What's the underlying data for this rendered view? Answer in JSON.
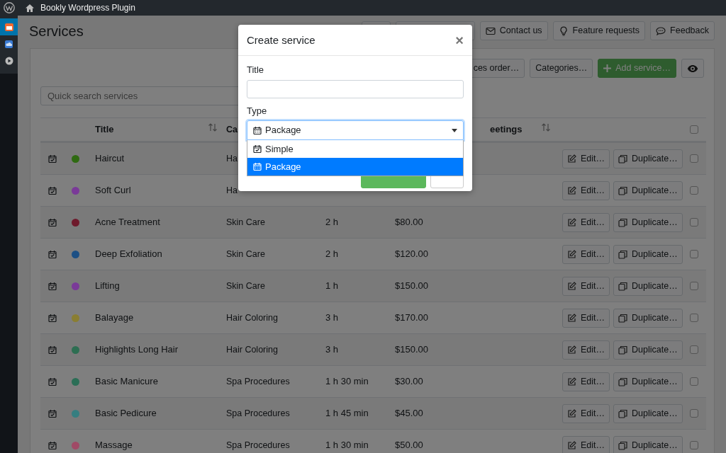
{
  "admin_bar": {
    "site": "Bookly Wordpress Plugin"
  },
  "sidebar": {
    "items": [
      {
        "kind": "calendar",
        "selected": true
      },
      {
        "kind": "cloud",
        "selected": false
      },
      {
        "kind": "play",
        "selected": false
      }
    ]
  },
  "page_title": "Services",
  "header_buttons": [
    {
      "kind": "envelope",
      "label": "Contact us"
    },
    {
      "kind": "bulb",
      "label": "Feature requests"
    },
    {
      "kind": "chat",
      "label": "Feedback"
    }
  ],
  "toolbar": {
    "search": {
      "placeholder": "Quick search services"
    },
    "buttons": [
      {
        "kind": "default",
        "label": "ces order…"
      },
      {
        "kind": "default",
        "label": "Categories…"
      },
      {
        "kind": "add",
        "label": "Add service…"
      },
      {
        "kind": "eye"
      }
    ]
  },
  "table": {
    "columns": [
      {
        "label": "Title",
        "sortable": true
      },
      {
        "label": "Ca",
        "sortable": false
      },
      {
        "label": "eetings",
        "sortable": true
      }
    ],
    "header_checked": false,
    "rows": [
      {
        "title": "Haircut",
        "category": "Ha",
        "color": "#2f6a12",
        "checked": false,
        "actions": [
          "Edit…",
          "Duplicate…"
        ]
      },
      {
        "title": "Soft Curl",
        "category": "Ha",
        "color": "#7a3a98",
        "checked": false,
        "actions": [
          "Edit…",
          "Duplicate…"
        ]
      },
      {
        "title": "Acne Treatment",
        "category": "Skin Care",
        "duration": "2 h",
        "price": "$80.00",
        "color": "#6e1a2c",
        "checked": false,
        "actions": [
          "Edit…",
          "Duplicate…"
        ]
      },
      {
        "title": "Deep Exfoliation",
        "category": "Skin Care",
        "duration": "2 h",
        "price": "$120.00",
        "color": "#1c4f84",
        "checked": false,
        "actions": [
          "Edit…",
          "Duplicate…"
        ]
      },
      {
        "title": "Lifting",
        "category": "Skin Care",
        "duration": "1 h",
        "price": "$150.00",
        "color": "#7a3a98",
        "checked": false,
        "actions": [
          "Edit…",
          "Duplicate…"
        ]
      },
      {
        "title": "Balayage",
        "category": "Hair Coloring",
        "duration": "3 h",
        "price": "$170.00",
        "color": "#8a7e32",
        "checked": false,
        "actions": [
          "Edit…",
          "Duplicate…"
        ]
      },
      {
        "title": "Highlights Long Hair",
        "category": "Hair Coloring",
        "duration": "3 h",
        "price": "$150.00",
        "color": "#2d6e52",
        "checked": false,
        "actions": [
          "Edit…",
          "Duplicate…"
        ]
      },
      {
        "title": "Basic Manicure",
        "category": "Spa Procedures",
        "duration": "1 h 30 min",
        "price": "$30.00",
        "color": "#2b6e56",
        "checked": false,
        "actions": [
          "Edit…",
          "Duplicate…"
        ]
      },
      {
        "title": "Basic Pedicure",
        "category": "Spa Procedures",
        "duration": "1 h 45 min",
        "price": "$45.00",
        "color": "#367e80",
        "checked": false,
        "actions": [
          "Edit…",
          "Duplicate…"
        ]
      },
      {
        "title": "Massage",
        "category": "Spa Procedures",
        "duration": "1 h 30 min",
        "price": "$50.00",
        "color": "#a04a66",
        "checked": false,
        "actions": [
          "Edit…",
          "Duplicate…"
        ]
      }
    ]
  },
  "modal": {
    "title": "Create service",
    "close": "×",
    "fields": [
      {
        "kind": "text",
        "label": "Title"
      },
      {
        "kind": "select",
        "label": "Type",
        "value": "Package",
        "focused": true,
        "expanded": true,
        "options": [
          {
            "kind": "simple",
            "label": "Simple",
            "selected": false
          },
          {
            "kind": "package",
            "label": "Package",
            "selected": true
          }
        ]
      }
    ],
    "buttons": [
      {
        "kind": "primary"
      },
      {
        "kind": "secondary"
      }
    ]
  }
}
